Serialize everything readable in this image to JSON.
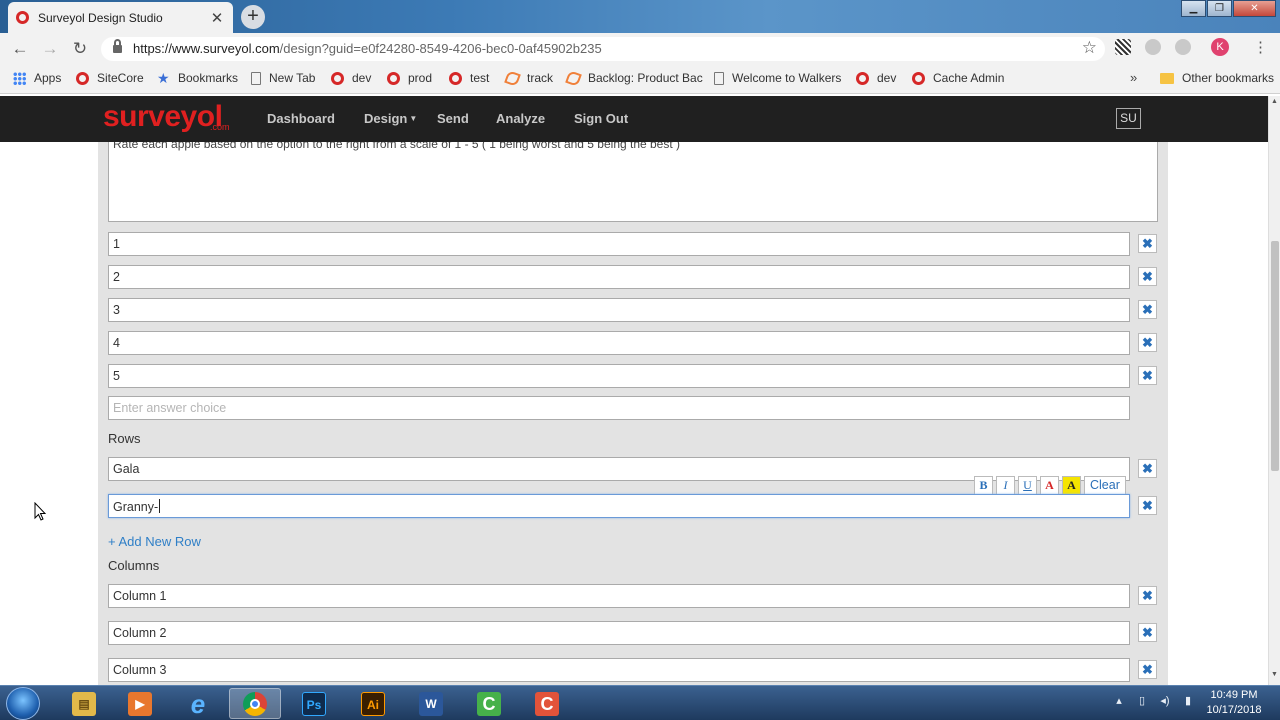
{
  "browser": {
    "tab_title": "Surveyol Design Studio",
    "tab_close": "✕",
    "new_tab": "+",
    "url_scheme_host": "https://www.surveyol.com",
    "url_path": "/design?guid=e0f24280-8549-4206-bec0-0af45902b235",
    "avatar_letter": "K",
    "bookmarks": [
      {
        "label": "Apps",
        "icon": "apps-icon"
      },
      {
        "label": "SiteCore",
        "icon": "opera-icon"
      },
      {
        "label": "Bookmarks",
        "icon": "star-icon"
      },
      {
        "label": "New Tab",
        "icon": "page-icon"
      },
      {
        "label": "dev",
        "icon": "opera-icon"
      },
      {
        "label": "prod",
        "icon": "opera-icon"
      },
      {
        "label": "test",
        "icon": "opera-icon"
      },
      {
        "label": "track",
        "icon": "track-icon"
      },
      {
        "label": "Backlog: Product Bac",
        "icon": "track-icon"
      },
      {
        "label": "Welcome to Walkers",
        "icon": "page-icon"
      },
      {
        "label": "dev",
        "icon": "opera-icon"
      },
      {
        "label": "Cache Admin",
        "icon": "opera-icon"
      }
    ],
    "bookmarks_more": "»",
    "other_bookmarks": "Other bookmarks"
  },
  "site": {
    "logo": "surveyol",
    "logo_suffix": ".com",
    "nav": {
      "dashboard": "Dashboard",
      "design": "Design",
      "design_caret": "▼",
      "send": "Send",
      "analyze": "Analyze",
      "sign_out": "Sign Out"
    },
    "user_badge": "SU",
    "brand_color": "#e02020"
  },
  "editor": {
    "question_text": "Rate each apple based on the option to the right from a scale of 1 - 5 ( 1 being worst and 5 being the best )",
    "answer_choices": [
      "1",
      "2",
      "3",
      "4",
      "5"
    ],
    "answer_placeholder": "Enter answer choice",
    "rows_label": "Rows",
    "rows": [
      "Gala"
    ],
    "active_row_value": "Granny-",
    "add_row_label": "+ Add New Row",
    "columns_label": "Columns",
    "columns": [
      "Column 1",
      "Column 2",
      "Column 3"
    ],
    "delete_glyph": "✖",
    "format_bar": {
      "bold": "B",
      "italic": "I",
      "underline": "U",
      "font_color": "A",
      "highlight": "A",
      "clear": "Clear"
    }
  },
  "taskbar": {
    "apps": [
      {
        "name": "explorer",
        "glyph": "▤",
        "color": "#e2b94a"
      },
      {
        "name": "media-player",
        "glyph": "▶",
        "color": "#e8772e"
      },
      {
        "name": "internet-explorer",
        "glyph": "e",
        "color": "#2a8ad8"
      },
      {
        "name": "chrome",
        "glyph": "●",
        "color": "#3a9a45"
      },
      {
        "name": "photoshop",
        "glyph": "Ps",
        "color": "#0f2b4d"
      },
      {
        "name": "illustrator",
        "glyph": "Ai",
        "color": "#f08a1d"
      },
      {
        "name": "word",
        "glyph": "W",
        "color": "#2b579a"
      },
      {
        "name": "camtasia-green",
        "glyph": "C",
        "color": "#46b14a"
      },
      {
        "name": "camtasia-red",
        "glyph": "C",
        "color": "#e2533a"
      }
    ],
    "time": "10:49 PM",
    "date": "10/17/2018"
  }
}
